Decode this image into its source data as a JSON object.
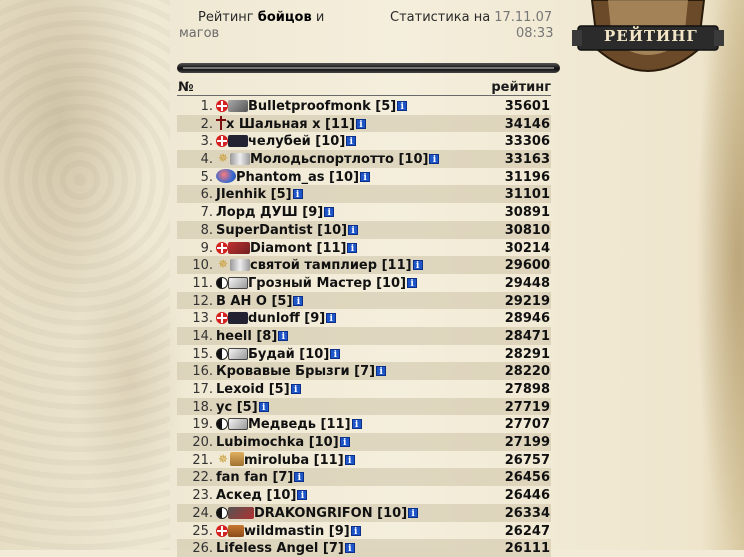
{
  "header": {
    "title_prefix": "Рейтинг",
    "title_bold": "бойцов",
    "title_suffix": "и",
    "title_line2": "магов",
    "stats_label": "Статистика на",
    "stats_date": "17.11.07",
    "stats_time": "08:33",
    "emblem_label": "РЕЙТИНГ"
  },
  "table": {
    "col_num": "№",
    "col_rating": "рейтинг",
    "rows": [
      {
        "rank": "1.",
        "badges": [
          "red",
          "claw"
        ],
        "name": "Bulletproofmonk",
        "level": "[5]",
        "score": "35601"
      },
      {
        "rank": "2.",
        "badges": [
          "cross"
        ],
        "name": "x Шальная x",
        "level": "[11]",
        "score": "34146"
      },
      {
        "rank": "3.",
        "badges": [
          "red",
          "mask"
        ],
        "name": "челубей",
        "level": "[10]",
        "score": "33306"
      },
      {
        "rank": "4.",
        "badges": [
          "star",
          "wing"
        ],
        "name": "Молодьспортлотто",
        "level": "[10]",
        "score": "33163"
      },
      {
        "rank": "5.",
        "badges": [
          "phantom"
        ],
        "name": "Phantom_as",
        "level": "[10]",
        "score": "31196"
      },
      {
        "rank": "6.",
        "badges": [],
        "name": "JIenhik",
        "level": "[5]",
        "score": "31101"
      },
      {
        "rank": "7.",
        "badges": [],
        "name": "Лорд ДУШ",
        "level": "[9]",
        "score": "30891"
      },
      {
        "rank": "8.",
        "badges": [],
        "name": "SuperDantist",
        "level": "[10]",
        "score": "30810"
      },
      {
        "rank": "9.",
        "badges": [
          "red",
          "axe"
        ],
        "name": "Diamont",
        "level": "[11]",
        "score": "30214"
      },
      {
        "rank": "10.",
        "badges": [
          "star",
          "wing"
        ],
        "name": "святой тамплиер",
        "level": "[11]",
        "score": "29600"
      },
      {
        "rank": "11.",
        "badges": [
          "yy",
          "hands"
        ],
        "name": "Грозный Мастер",
        "level": "[10]",
        "score": "29448"
      },
      {
        "rank": "12.",
        "badges": [],
        "name": "В АН О",
        "level": "[5]",
        "score": "29219"
      },
      {
        "rank": "13.",
        "badges": [
          "red",
          "mask"
        ],
        "name": "dunloff",
        "level": "[9]",
        "score": "28946"
      },
      {
        "rank": "14.",
        "badges": [],
        "name": "heell",
        "level": "[8]",
        "score": "28471"
      },
      {
        "rank": "15.",
        "badges": [
          "yy",
          "hands"
        ],
        "name": "Будай",
        "level": "[10]",
        "score": "28291"
      },
      {
        "rank": "16.",
        "badges": [],
        "name": "Кровавые Брызги",
        "level": "[7]",
        "score": "28220"
      },
      {
        "rank": "17.",
        "badges": [],
        "name": "Lexoid",
        "level": "[5]",
        "score": "27898"
      },
      {
        "rank": "18.",
        "badges": [],
        "name": "yc",
        "level": "[5]",
        "score": "27719"
      },
      {
        "rank": "19.",
        "badges": [
          "yy",
          "hands"
        ],
        "name": "Медведь",
        "level": "[11]",
        "score": "27707"
      },
      {
        "rank": "20.",
        "badges": [],
        "name": "Lubimochka",
        "level": "[10]",
        "score": "27199"
      },
      {
        "rank": "21.",
        "badges": [
          "star",
          "temple"
        ],
        "name": "miroluba",
        "level": "[11]",
        "score": "26757"
      },
      {
        "rank": "22.",
        "badges": [],
        "name": "fan fan",
        "level": "[7]",
        "score": "26456"
      },
      {
        "rank": "23.",
        "badges": [],
        "name": "Аскед",
        "level": "[10]",
        "score": "26446"
      },
      {
        "rank": "24.",
        "badges": [
          "yy",
          "dragon"
        ],
        "name": "DRAKONGRIFON",
        "level": "[10]",
        "score": "26334"
      },
      {
        "rank": "25.",
        "badges": [
          "red",
          "chest"
        ],
        "name": "wildmastin",
        "level": "[9]",
        "score": "26247"
      },
      {
        "rank": "26.",
        "badges": [],
        "name": "Lifeless Angel",
        "level": "[7]",
        "score": "26111"
      }
    ]
  },
  "colors": {
    "info_icon": "#1e56c8",
    "row_alt": "#cdc3a8",
    "clan_red": "#d32020"
  },
  "icons": {
    "info": "info-icon",
    "red": "red-cross-clan-icon",
    "cross": "dark-cross-icon",
    "yy": "yin-yang-icon",
    "star": "light-star-icon"
  }
}
